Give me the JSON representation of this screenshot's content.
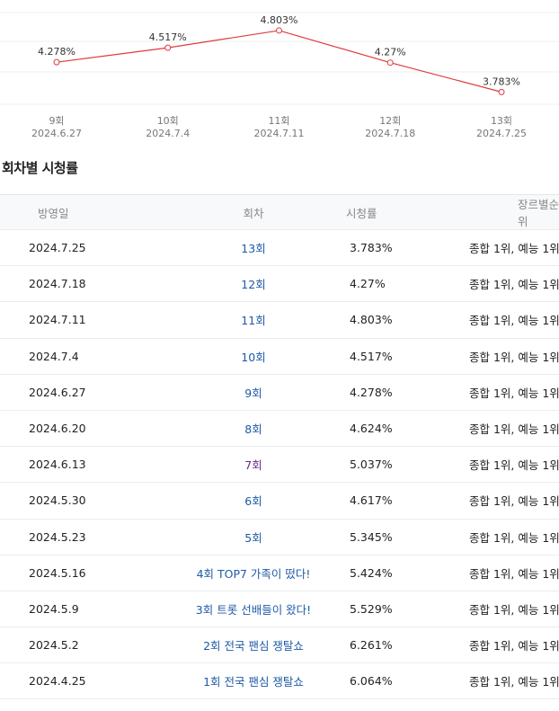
{
  "chart_data": {
    "type": "line",
    "x": [
      "9회",
      "10회",
      "11회",
      "12회",
      "13회"
    ],
    "dates": [
      "2024.6.27",
      "2024.7.4",
      "2024.7.11",
      "2024.7.18",
      "2024.7.25"
    ],
    "values": [
      4.278,
      4.517,
      4.803,
      4.27,
      3.783
    ],
    "value_labels": [
      "4.278%",
      "4.517%",
      "4.803%",
      "4.27%",
      "3.783%"
    ],
    "ylim": [
      3.58,
      5.1
    ],
    "grid": true,
    "line_color": "#e0393e"
  },
  "section": {
    "title": "회차별 시청률"
  },
  "table": {
    "headers": {
      "date": "방영일",
      "episode": "회차",
      "rating": "시청률",
      "rank": "장르별순위"
    },
    "rows": [
      {
        "date": "2024.7.25",
        "episode": "13회",
        "rating": "3.783%",
        "rank": "종합 1위, 예능 1위",
        "visited": false
      },
      {
        "date": "2024.7.18",
        "episode": "12회",
        "rating": "4.27%",
        "rank": "종합 1위, 예능 1위",
        "visited": false
      },
      {
        "date": "2024.7.11",
        "episode": "11회",
        "rating": "4.803%",
        "rank": "종합 1위, 예능 1위",
        "visited": false
      },
      {
        "date": "2024.7.4",
        "episode": "10회",
        "rating": "4.517%",
        "rank": "종합 1위, 예능 1위",
        "visited": false
      },
      {
        "date": "2024.6.27",
        "episode": "9회",
        "rating": "4.278%",
        "rank": "종합 1위, 예능 1위",
        "visited": false
      },
      {
        "date": "2024.6.20",
        "episode": "8회",
        "rating": "4.624%",
        "rank": "종합 1위, 예능 1위",
        "visited": false
      },
      {
        "date": "2024.6.13",
        "episode": "7회",
        "rating": "5.037%",
        "rank": "종합 1위, 예능 1위",
        "visited": true
      },
      {
        "date": "2024.5.30",
        "episode": "6회",
        "rating": "4.617%",
        "rank": "종합 1위, 예능 1위",
        "visited": false
      },
      {
        "date": "2024.5.23",
        "episode": "5회",
        "rating": "5.345%",
        "rank": "종합 1위, 예능 1위",
        "visited": false
      },
      {
        "date": "2024.5.16",
        "episode": "4회 TOP7 가족이 떴다!",
        "rating": "5.424%",
        "rank": "종합 1위, 예능 1위",
        "visited": false
      },
      {
        "date": "2024.5.9",
        "episode": "3회 트롯 선배들이 왔다!",
        "rating": "5.529%",
        "rank": "종합 1위, 예능 1위",
        "visited": false
      },
      {
        "date": "2024.5.2",
        "episode": "2회 전국 팬심 쟁탈쇼",
        "rating": "6.261%",
        "rank": "종합 1위, 예능 1위",
        "visited": false
      },
      {
        "date": "2024.4.25",
        "episode": "1회 전국 팬심 쟁탈쇼",
        "rating": "6.064%",
        "rank": "종합 1위, 예능 1위",
        "visited": false
      }
    ]
  }
}
